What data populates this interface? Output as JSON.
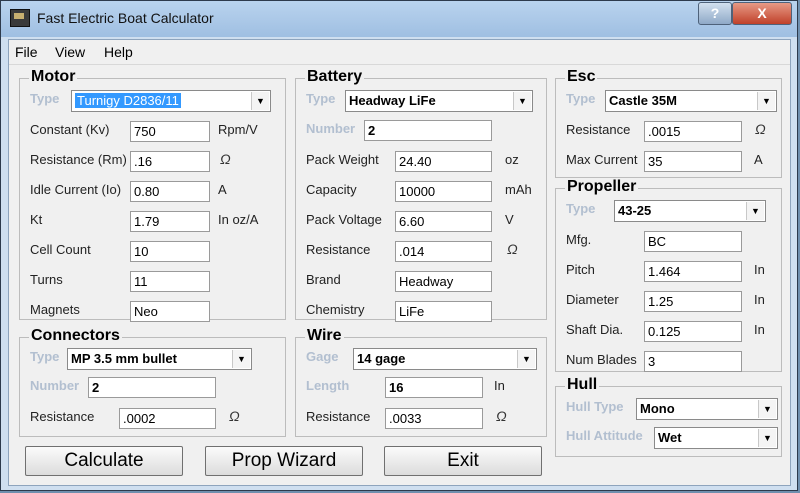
{
  "window": {
    "title": "Fast Electric Boat Calculator",
    "help_glyph": "?",
    "close_glyph": "X"
  },
  "menu": [
    "File",
    "View",
    "Help"
  ],
  "motor": {
    "title": "Motor",
    "type_label": "Type",
    "type_value": "Turnigy D2836/11",
    "rows": [
      {
        "label": "Constant (Kv)",
        "value": "750",
        "unit": "Rpm/V"
      },
      {
        "label": "Resistance (Rm)",
        "value": ".16",
        "unit": "Ω"
      },
      {
        "label": "Idle Current (Io)",
        "value": "0.80",
        "unit": "A"
      },
      {
        "label": "Kt",
        "value": "1.79",
        "unit": "In oz/A"
      },
      {
        "label": "Cell Count",
        "value": "10",
        "unit": ""
      },
      {
        "label": "Turns",
        "value": "11",
        "unit": ""
      },
      {
        "label": "Magnets",
        "value": "Neo",
        "unit": ""
      }
    ]
  },
  "battery": {
    "title": "Battery",
    "type_label": "Type",
    "type_value": "Headway LiFe",
    "number_label": "Number",
    "number_value": "2",
    "rows": [
      {
        "label": "Pack Weight",
        "value": "24.40",
        "unit": "oz"
      },
      {
        "label": "Capacity",
        "value": "10000",
        "unit": "mAh"
      },
      {
        "label": "Pack Voltage",
        "value": "6.60",
        "unit": "V"
      },
      {
        "label": "Resistance",
        "value": ".014",
        "unit": "Ω"
      },
      {
        "label": "Brand",
        "value": "Headway",
        "unit": ""
      },
      {
        "label": "Chemistry",
        "value": "LiFe",
        "unit": ""
      }
    ]
  },
  "esc": {
    "title": "Esc",
    "type_label": "Type",
    "type_value": "Castle 35M",
    "rows": [
      {
        "label": "Resistance",
        "value": ".0015",
        "unit": "Ω"
      },
      {
        "label": "Max Current",
        "value": "35",
        "unit": "A"
      }
    ]
  },
  "propeller": {
    "title": "Propeller",
    "type_label": "Type",
    "type_value": "43-25",
    "rows": [
      {
        "label": "Mfg.",
        "value": "BC",
        "unit": ""
      },
      {
        "label": "Pitch",
        "value": "1.464",
        "unit": "In"
      },
      {
        "label": "Diameter",
        "value": "1.25",
        "unit": "In"
      },
      {
        "label": "Shaft Dia.",
        "value": "0.125",
        "unit": "In"
      },
      {
        "label": "Num Blades",
        "value": "3",
        "unit": ""
      }
    ]
  },
  "connectors": {
    "title": "Connectors",
    "type_label": "Type",
    "type_value": "MP 3.5 mm bullet",
    "number_label": "Number",
    "number_value": "2",
    "resistance_label": "Resistance",
    "resistance_value": ".0002",
    "resistance_unit": "Ω"
  },
  "wire": {
    "title": "Wire",
    "gage_label": "Gage",
    "gage_value": "14 gage",
    "length_label": "Length",
    "length_value": "16",
    "length_unit": "In",
    "resistance_label": "Resistance",
    "resistance_value": ".0033",
    "resistance_unit": "Ω"
  },
  "hull": {
    "title": "Hull",
    "type_label": "Hull Type",
    "type_value": "Mono",
    "attitude_label": "Hull Attitude",
    "attitude_value": "Wet"
  },
  "buttons": {
    "calculate": "Calculate",
    "prop_wizard": "Prop Wizard",
    "exit": "Exit"
  }
}
